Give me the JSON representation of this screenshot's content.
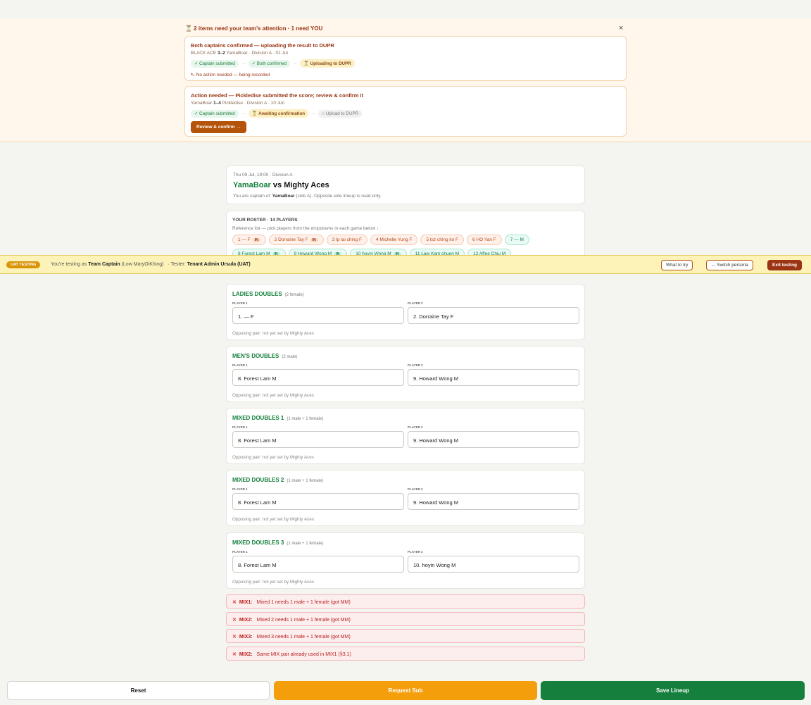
{
  "attention": {
    "title": "⏳ 2 items need your team's attention · 1 need YOU",
    "close": "×",
    "items": [
      {
        "title": "Both captains confirmed — uploading the result to DUPR",
        "team_a": "BLACK ACE",
        "score": "3–2",
        "team_b": "YamaBoar",
        "division": "Division A",
        "date": "01 Jul",
        "steps": [
          "✓ Captain submitted",
          "✓ Both confirmed",
          "⏳ Uploading to DUPR"
        ],
        "note": "⮑ No action needed — being recorded"
      },
      {
        "title": "Action needed — Pickledise submitted the score; review & confirm it",
        "team_a": "YamaBoar",
        "score": "1–4",
        "team_b": "Pickledise",
        "division": "Division A",
        "date": "10 Jun",
        "steps": [
          "✓ Captain submitted",
          "⏳ Awaiting confirmation",
          "○ Upload to DUPR"
        ],
        "button": "Review & confirm →"
      }
    ]
  },
  "match": {
    "meta": "Thu 09 Jul, 19:00 · Division A",
    "home": "YamaBoar",
    "vs": "vs",
    "away": "Mighty Aces",
    "captain_prefix": "You are captain of:",
    "captain_team": "YamaBoar",
    "captain_suffix": "(side A). Opposite side lineup is read-only."
  },
  "roster": {
    "title": "YOUR ROSTER · 14 PLAYERS",
    "subtitle": "Reference list — pick players from the dropdowns in each game below ↓",
    "row1": [
      {
        "label": "1 — F",
        "in": "IN",
        "g": "f"
      },
      {
        "label": "2 Dorraine Tay F",
        "in": "IN",
        "g": "f"
      },
      {
        "label": "3 Ip lai ching F",
        "in": "",
        "g": "f"
      },
      {
        "label": "4 Michelle Yung F",
        "in": "",
        "g": "f"
      },
      {
        "label": "5 tsz ching ko F",
        "in": "",
        "g": "f"
      },
      {
        "label": "6 HO Yan F",
        "in": "",
        "g": "f"
      },
      {
        "label": "7 — M",
        "in": "",
        "g": "m"
      }
    ],
    "row2": [
      {
        "label": "8 Forest Lam M",
        "in": "IN",
        "g": "m"
      },
      {
        "label": "9 Howard Wong M",
        "in": "IN",
        "g": "m"
      },
      {
        "label": "10 hoyin Wong M",
        "in": "IN",
        "g": "m"
      },
      {
        "label": "11 Law Kam chuen M",
        "in": "",
        "g": "m"
      },
      {
        "label": "12 Affee Chiu M",
        "in": "",
        "g": "m"
      }
    ]
  },
  "uat": {
    "badge": "UAT TESTING",
    "prefix": "You're testing as",
    "role": "Team Captain",
    "persona": "(Low MaryOiKhing)",
    "tester_label": "· Tester:",
    "tester": "Tenant Admin Ursula (UAT)",
    "what": "What to try",
    "switch": "↔ Switch persona",
    "exit": "Exit testing"
  },
  "games": [
    {
      "title": "LADIES DOUBLES",
      "req": "(2 female)",
      "p1_label": "PLAYER 1",
      "p2_label": "PLAYER 2",
      "p1": "1. — F",
      "p2": "2. Dorraine Tay F",
      "opp": "Opposing pair: not yet set by Mighty Aces"
    },
    {
      "title": "MEN'S DOUBLES",
      "req": "(2 male)",
      "p1_label": "PLAYER 1",
      "p2_label": "PLAYER 2",
      "p1": "8. Forest Lam M",
      "p2": "9. Howard Wong M",
      "opp": "Opposing pair: not yet set by Mighty Aces"
    },
    {
      "title": "MIXED DOUBLES 1",
      "req": "(1 male + 1 female)",
      "p1_label": "PLAYER 1",
      "p2_label": "PLAYER 2",
      "p1": "8. Forest Lam M",
      "p2": "9. Howard Wong M",
      "opp": "Opposing pair: not yet set by Mighty Aces"
    },
    {
      "title": "MIXED DOUBLES 2",
      "req": "(1 male + 1 female)",
      "p1_label": "PLAYER 1",
      "p2_label": "PLAYER 2",
      "p1": "8. Forest Lam M",
      "p2": "9. Howard Wong M",
      "opp": "Opposing pair: not yet set by Mighty Aces"
    },
    {
      "title": "MIXED DOUBLES 3",
      "req": "(1 male + 1 female)",
      "p1_label": "PLAYER 1",
      "p2_label": "PLAYER 2",
      "p1": "8. Forest Lam M",
      "p2": "10. hoyin Wong M",
      "opp": "Opposing pair: not yet set by Mighty Aces"
    }
  ],
  "errors": [
    {
      "code": "MIX1:",
      "msg": "Mixed 1 needs 1 male + 1 female (got MM)"
    },
    {
      "code": "MIX2:",
      "msg": "Mixed 2 needs 1 male + 1 female (got MM)"
    },
    {
      "code": "MIX3:",
      "msg": "Mixed 3 needs 1 male + 1 female (got MM)"
    },
    {
      "code": "MIX2:",
      "msg": "Same MIX pair already used in MIX1 (§3.1)"
    }
  ],
  "error_icon": "✕",
  "footer": {
    "reset": "Reset",
    "request_sub": "Request Sub",
    "save": "Save Lineup"
  },
  "colors": {
    "accent_green": "#15803d",
    "save_green": "#15803d",
    "request_orange": "#f59e0b",
    "uat_yellow": "#fdf3b8",
    "error_red": "#b91c1c"
  }
}
